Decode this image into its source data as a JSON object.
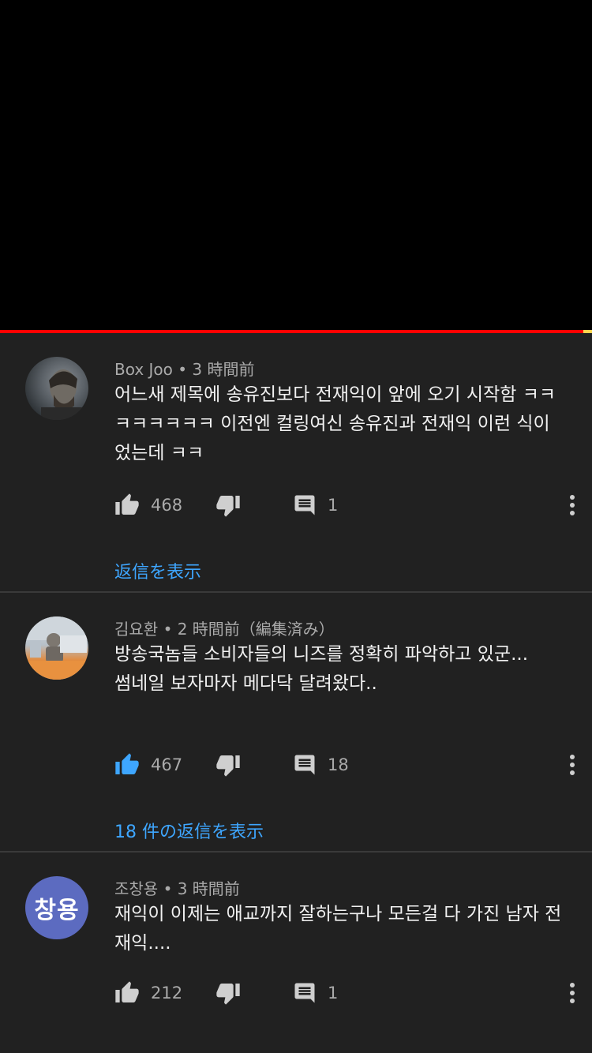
{
  "player": {
    "progress_fraction": 0.985
  },
  "comments": [
    {
      "avatar_type": "photo",
      "author": "Box Joo",
      "time": "3 時間前",
      "text": "어느새 제목에 송유진보다 전재익이 앞에 오기 시작함 ㅋㅋㅋㅋㅋㅋㅋㅋ 이전엔 컬링여신 송유진과 전재익 이런 식이었는데 ㅋㅋ",
      "likes": "468",
      "replies": "1",
      "liked": false,
      "show_replies_label": "返信を表示"
    },
    {
      "avatar_type": "photo",
      "author": "김요환",
      "time": "2 時間前（編集済み）",
      "text": "방송국놈들 소비자들의 니즈를 정확히 파악하고 있군...\n썸네일 보자마자 메다닥 달려왔다..",
      "likes": "467",
      "replies": "18",
      "liked": true,
      "show_replies_label": "18 件の返信を表示"
    },
    {
      "avatar_type": "initials",
      "avatar_initials": "창용",
      "avatar_color": "#5c6bc0",
      "author": "조창용",
      "time": "3 時間前",
      "text": "재익이 이제는 애교까지 잘하는구나 모든걸 다 가진 남자 전재익....",
      "likes": "212",
      "replies": "1",
      "liked": false
    }
  ],
  "colors": {
    "accent_link": "#3ea6ff",
    "progress": "#ff0000",
    "liked_icon": "#3ea6ff"
  }
}
